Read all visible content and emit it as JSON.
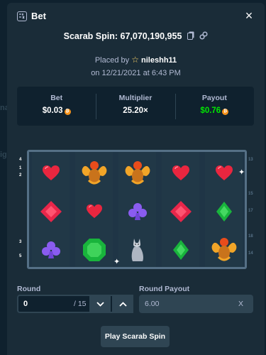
{
  "background": {
    "hint_1": "na",
    "hint_2": "igh"
  },
  "header": {
    "title": "Bet",
    "close_label": "×"
  },
  "spin": {
    "label": "Scarab Spin: 67,070,190,955",
    "placed_by_prefix": "Placed by",
    "username": "nileshh11",
    "placed_on": "on 12/21/2021 at 6:43 PM"
  },
  "stats": {
    "bet_label": "Bet",
    "bet_value": "$0.03",
    "multiplier_label": "Multiplier",
    "multiplier_value": "25.20×",
    "payout_label": "Payout",
    "payout_value": "$0.76"
  },
  "board": {
    "paylines_left": [
      "4",
      "1",
      "2",
      "3",
      "5"
    ],
    "paylines_right": [
      "13",
      "15",
      "17",
      "18",
      "14"
    ],
    "reels": [
      [
        "heart",
        "diamond",
        "club"
      ],
      [
        "scarab",
        "heart",
        "emerald"
      ],
      [
        "scarab",
        "club",
        "cat"
      ],
      [
        "heart",
        "diamond",
        "gem-green"
      ],
      [
        "heart",
        "gem-green",
        "scarab"
      ]
    ]
  },
  "controls": {
    "round_label": "Round",
    "round_value": "0",
    "round_total": "/ 15",
    "round_payout_label": "Round Payout",
    "round_payout_value": "6.00",
    "round_payout_clear": "X",
    "play_label": "Play Scarab Spin"
  },
  "colors": {
    "background": "#0f212e",
    "modal": "#1a2c38",
    "accent_green": "#00e701",
    "coin": "#f7931a",
    "heart": "#e9263f",
    "diamond": "#e8264a",
    "club": "#8a5cf0",
    "gem_green": "#19b43c",
    "scarab_gold": "#f2a528"
  }
}
